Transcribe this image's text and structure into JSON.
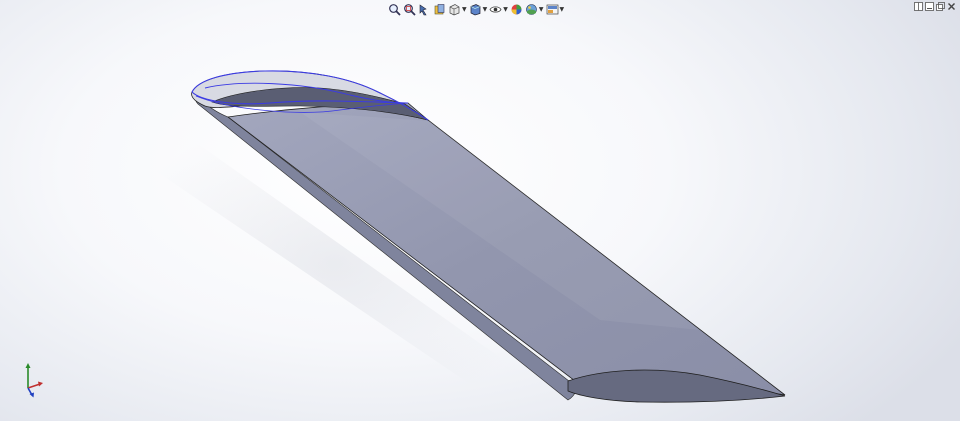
{
  "app": {
    "title": ""
  },
  "colors": {
    "background_top": "#ffffff",
    "background_edge": "#dfe2ea",
    "part_face": "#8f93ad",
    "part_top_face": "#9da1b9",
    "part_dark_face": "#6c7089",
    "sketch_curve": "#3a3ae0",
    "edge_line": "#222222"
  },
  "heads_up_toolbar": {
    "items": [
      {
        "name": "zoom-to-fit",
        "icon": "magnifier-fit-icon"
      },
      {
        "name": "zoom-to-area",
        "icon": "magnifier-area-icon"
      },
      {
        "name": "previous-view",
        "icon": "previous-view-icon"
      },
      {
        "name": "section-view",
        "icon": "section-view-icon"
      },
      {
        "name": "view-orientation",
        "icon": "view-orientation-icon",
        "dropdown": true
      },
      {
        "name": "display-style",
        "icon": "display-style-icon",
        "dropdown": true
      },
      {
        "name": "hide-show-items",
        "icon": "eye-icon",
        "dropdown": true
      },
      {
        "name": "edit-appearance",
        "icon": "appearance-ball-icon"
      },
      {
        "name": "apply-scene",
        "icon": "scene-icon",
        "dropdown": true
      },
      {
        "name": "view-settings",
        "icon": "view-settings-icon",
        "dropdown": true
      }
    ]
  },
  "window_controls": [
    "split-view-icon",
    "restore-icon",
    "maximize-icon",
    "close-icon"
  ],
  "triad": {
    "x": "",
    "y": "",
    "z": ""
  }
}
